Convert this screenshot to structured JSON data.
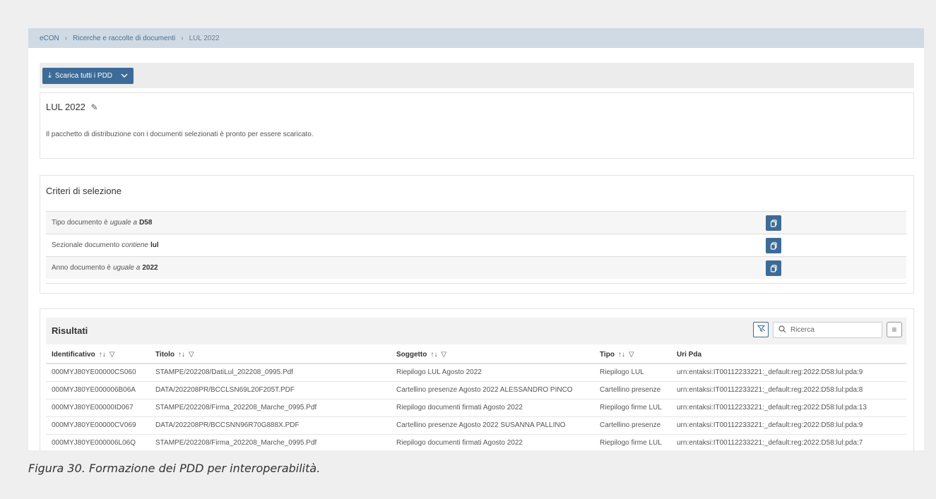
{
  "breadcrumb": {
    "items": [
      "eCON",
      "Ricerche e raccolte di documenti",
      "LUL 2022"
    ],
    "separator": "›"
  },
  "toolbar": {
    "download_icon": "download-icon",
    "download_label": "Scarica tutti i PDD",
    "dropdown_icon": "chevron-down-icon"
  },
  "package": {
    "title": "LUL 2022",
    "edit_icon": "pencil-icon",
    "description": "Il pacchetto di distribuzione con i documenti selezionati è pronto per essere scaricato."
  },
  "criteria": {
    "title": "Criteri di selezione",
    "rows": [
      {
        "field": "Tipo documento è",
        "operator": "uguale a",
        "value": "D58"
      },
      {
        "field": "Sezionale documento",
        "operator": "contiene",
        "value": "lul"
      },
      {
        "field": "Anno documento è",
        "operator": "uguale a",
        "value": "2022"
      }
    ],
    "action_icon": "copy-icon"
  },
  "results": {
    "title": "Risultati",
    "search_placeholder": "Ricerca",
    "columns": [
      {
        "label": "Identificativo",
        "sortable": true,
        "filterable": true
      },
      {
        "label": "Titolo",
        "sortable": true,
        "filterable": true
      },
      {
        "label": "Soggetto",
        "sortable": true,
        "filterable": true
      },
      {
        "label": "Tipo",
        "sortable": true,
        "filterable": true
      },
      {
        "label": "Uri Pda",
        "sortable": false,
        "filterable": false
      }
    ],
    "rows": [
      [
        "000MYJ80YE00000CS060",
        "STAMPE/202208/DatiLul_202208_0995.Pdf",
        "Riepilogo LUL Agosto 2022",
        "Riepilogo LUL",
        "urn:entaksi:IT00112233221:_default:reg:2022:D58:lul:pda:9"
      ],
      [
        "000MYJ80YE000006B06A",
        "DATA/202208PR/BCCLSN69L20F205T.PDF",
        "Cartellino presenze Agosto 2022 ALESSANDRO PINCO",
        "Cartellino presenze",
        "urn:entaksi:IT00112233221:_default:reg:2022:D58:lul:pda:8"
      ],
      [
        "000MYJ80YE00000ID067",
        "STAMPE/202208/Firma_202208_Marche_0995.Pdf",
        "Riepilogo documenti firmati Agosto 2022",
        "Riepilogo firme LUL",
        "urn:entaksi:IT00112233221:_default:reg:2022:D58:lul:pda:13"
      ],
      [
        "000MYJ80YE00000CV069",
        "DATA/202208PR/BCCSNN96R70G888X.PDF",
        "Cartellino presenze Agosto 2022 SUSANNA PALLINO",
        "Cartellino presenze",
        "urn:entaksi:IT00112233221:_default:reg:2022:D58:lul:pda:9"
      ],
      [
        "000MYJ80YE000006L06Q",
        "STAMPE/202208/Firma_202208_Marche_0995.Pdf",
        "Riepilogo documenti firmati Agosto 2022",
        "Riepilogo firme LUL",
        "urn:entaksi:IT00112233221:_default:reg:2022:D58:lul:pda:7"
      ]
    ]
  },
  "caption": "Figura 30. Formazione dei PDD per interoperabilità.",
  "colors": {
    "accent": "#3d6b98",
    "breadcrumb_bg": "#cfdae4",
    "page_bg": "#efefef"
  }
}
